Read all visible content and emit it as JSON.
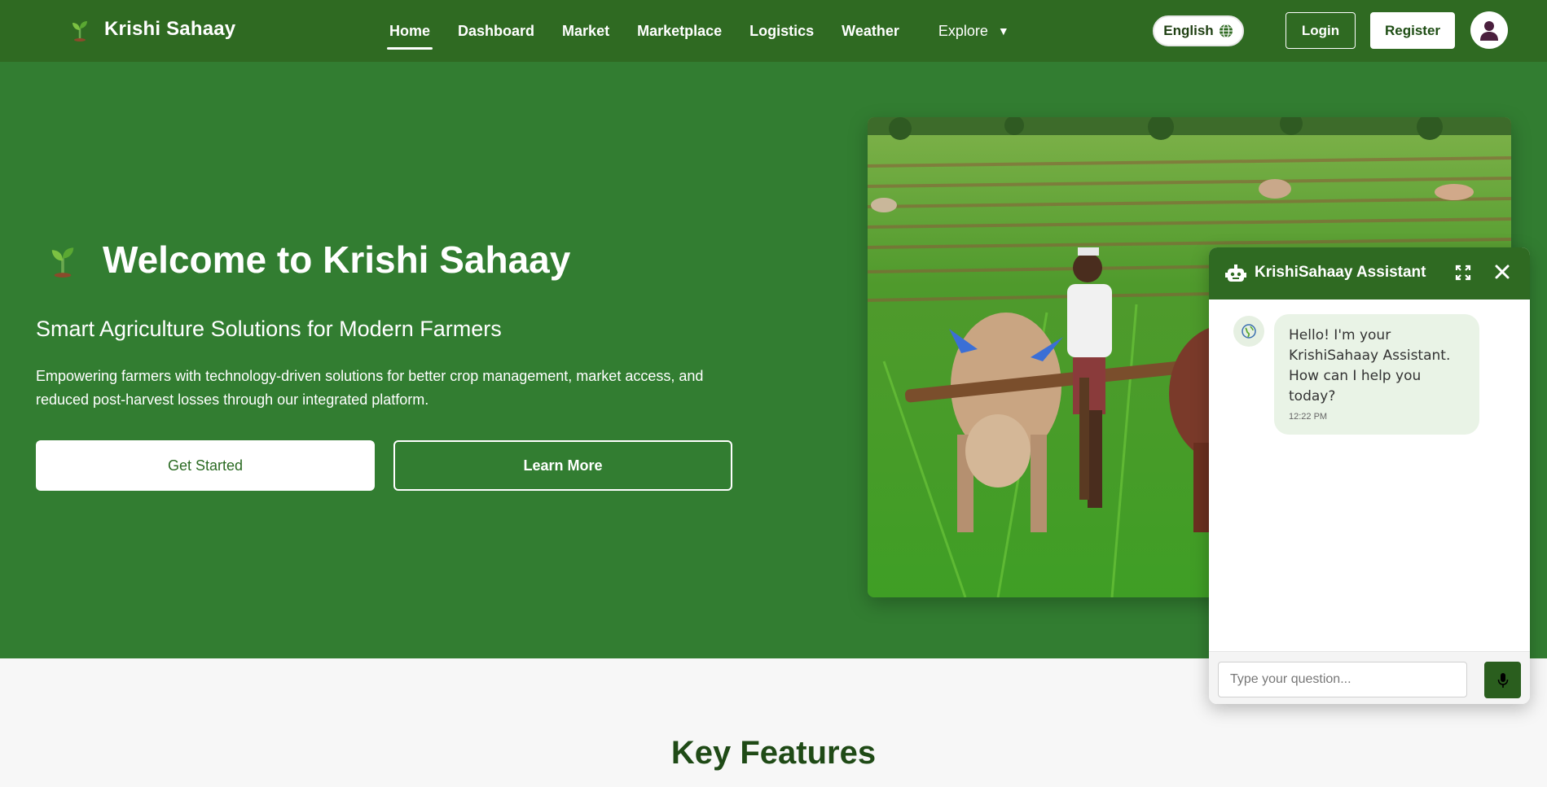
{
  "navbar": {
    "brand_name": "Krishi Sahaay",
    "links": [
      "Home",
      "Dashboard",
      "Market",
      "Marketplace",
      "Logistics",
      "Weather"
    ],
    "active_link": "Home",
    "explore_label": "Explore",
    "language_label": "English",
    "login_label": "Login",
    "register_label": "Register"
  },
  "hero": {
    "title": "Welcome to Krishi Sahaay",
    "subtitle": "Smart Agriculture Solutions for Modern Farmers",
    "description": "Empowering farmers with technology-driven solutions for better crop management, market access, and reduced post-harvest losses through our integrated platform.",
    "get_started_label": "Get Started",
    "learn_more_label": "Learn More",
    "image_subject": "farmer ploughing field with two bullocks"
  },
  "features": {
    "title": "Key Features"
  },
  "chat": {
    "title": "KrishiSahaay Assistant",
    "messages": [
      {
        "from": "bot",
        "text": "Hello! I'm your KrishiSahaay Assistant. How can I help you today?",
        "time": "12:22 PM"
      }
    ],
    "input_placeholder": "Type your question..."
  },
  "icons": {
    "brand": "seedling-icon",
    "language": "globe-icon",
    "profile": "user-icon",
    "chat_header": "robot-icon",
    "expand": "expand-icon",
    "close": "close-icon",
    "send": "microphone-icon"
  },
  "colors": {
    "nav_bg": "#2f6a22",
    "hero_bg": "#327d31",
    "accent_dark": "#1f4a16",
    "bubble_bg": "#e9f3e6"
  }
}
